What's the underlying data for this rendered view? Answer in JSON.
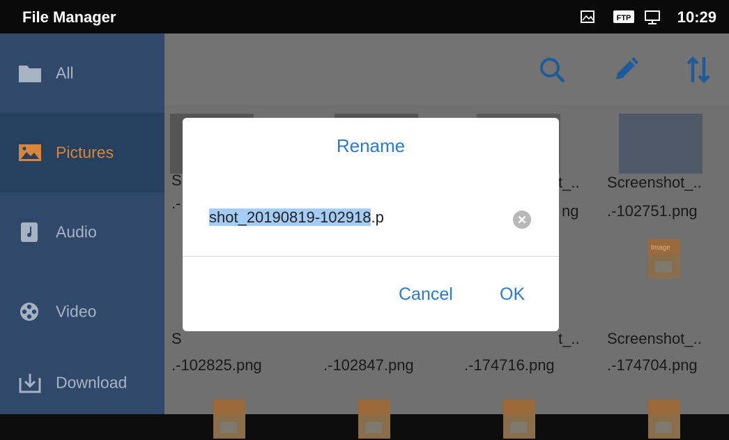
{
  "status_bar": {
    "app_title": "File Manager",
    "time": "10:29",
    "icons": [
      "screenshot-icon",
      "ftp-icon",
      "ethernet-icon"
    ],
    "ftp_label": "FTP"
  },
  "sidebar": {
    "items": [
      {
        "label": "All",
        "icon": "folder-icon",
        "active": false
      },
      {
        "label": "Pictures",
        "icon": "image-icon",
        "active": true
      },
      {
        "label": "Audio",
        "icon": "music-icon",
        "active": false
      },
      {
        "label": "Video",
        "icon": "film-reel-icon",
        "active": false
      },
      {
        "label": "Download",
        "icon": "download-icon",
        "active": false
      }
    ]
  },
  "toolbar": {
    "icons": [
      "search-icon",
      "edit-icon",
      "sort-icon"
    ]
  },
  "grid": {
    "row1": [
      {
        "name_line1": "S",
        "name_line2": ".-"
      },
      {
        "name_line1": "",
        "name_line2": ""
      },
      {
        "name_line1": "t_..",
        "name_line2": "ng"
      },
      {
        "name_line1": "Screenshot_..",
        "name_line2": ".-102751.png"
      }
    ],
    "row2": [
      {
        "name_line1": "S",
        "name_line2": ".-102825.png"
      },
      {
        "name_line1": "",
        "name_line2": ".-102847.png"
      },
      {
        "name_line1": "t_..",
        "name_line2": ".-174716.png"
      },
      {
        "name_line1": "Screenshot_..",
        "name_line2": ".-174704.png"
      }
    ],
    "image_icon_label": "Image"
  },
  "dialog": {
    "title": "Rename",
    "input_selected": "shot_20190819-102918",
    "input_unselected": ".p",
    "cancel_label": "Cancel",
    "ok_label": "OK"
  },
  "colors": {
    "accent": "#2a7ad3",
    "sidebar_bg": "#30496a",
    "sidebar_active": "#d9853a",
    "overlay": "#707070"
  }
}
